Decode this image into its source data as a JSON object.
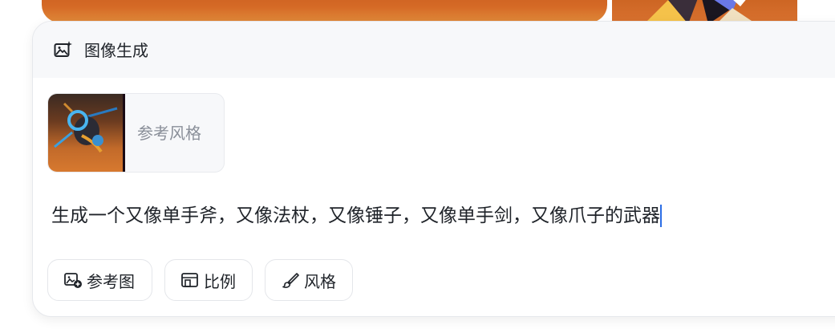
{
  "header": {
    "icon": "image-sparkle-icon",
    "title": "图像生成"
  },
  "reference": {
    "label": "参考风格",
    "thumbnail": "weapon-thumbnail"
  },
  "prompt": {
    "text": "生成一个又像单手斧，又像法杖，又像锤子，又像单手剑，又像爪子的武器"
  },
  "toolbar": {
    "buttons": [
      {
        "label": "参考图",
        "icon": "image-add-icon"
      },
      {
        "label": "比例",
        "icon": "aspect-ratio-icon"
      },
      {
        "label": "风格",
        "icon": "brush-icon"
      }
    ]
  },
  "colors": {
    "accent": "#2b6de5",
    "text": "#1f2329",
    "muted": "#8a8f99",
    "header_bg": "#f7f8fa",
    "background_image": "#d56a26"
  }
}
